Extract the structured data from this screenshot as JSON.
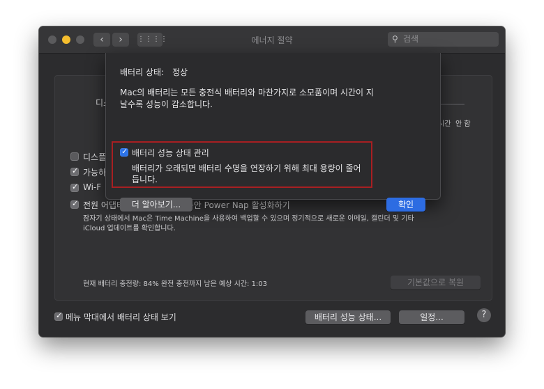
{
  "window": {
    "title": "에너지 절약"
  },
  "search": {
    "placeholder": "검색"
  },
  "main": {
    "left_partial_label": "디스",
    "partial_right_labels": [
      "시간",
      "안 함"
    ],
    "options": [
      {
        "label": "디스플",
        "checked": false
      },
      {
        "label": "가능하",
        "checked": true
      },
      {
        "label": "Wi-F",
        "checked": true
      },
      {
        "label": "전원 어댑터에 연결되어 있는 동안 Power Nap 활성화하기",
        "checked": true
      }
    ],
    "power_nap_desc_1": "잠자기 상태에서 Mac은 Time Machine을 사용하여 백업할 수 있으며 정기적으로 새로운 이메일, 캘린더 및 기타",
    "power_nap_desc_2": "iCloud 업데이트를 확인합니다.",
    "battery_status": "현재 배터리 충전량: 84% 완전 충전까지 남은 예상 시간: 1:03",
    "restore_defaults": "기본값으로 복원"
  },
  "footer": {
    "menubar_checkbox_label": "메뉴 막대에서 배터리 상태 보기",
    "battery_health_button": "배터리 성능 상태...",
    "schedule_button": "일정...",
    "help": "?"
  },
  "sheet": {
    "status_label": "배터리 상태:",
    "status_value": "정상",
    "description_1": "Mac의 배터리는 모든 충전식 배터리와 마찬가지로 소모품이며 시간이 지",
    "description_2": "날수록 성능이 감소합니다.",
    "manage_label": "배터리 성능 상태 관리",
    "manage_desc_1": "배터리가 오래되면 배터리 수명을 연장하기 위해 최대 용량이 줄어",
    "manage_desc_2": "듭니다.",
    "learn_more": "더 알아보기...",
    "ok": "확인"
  },
  "colors": {
    "highlight_border": "#a81f22",
    "accent_blue": "#2d6ce2"
  }
}
